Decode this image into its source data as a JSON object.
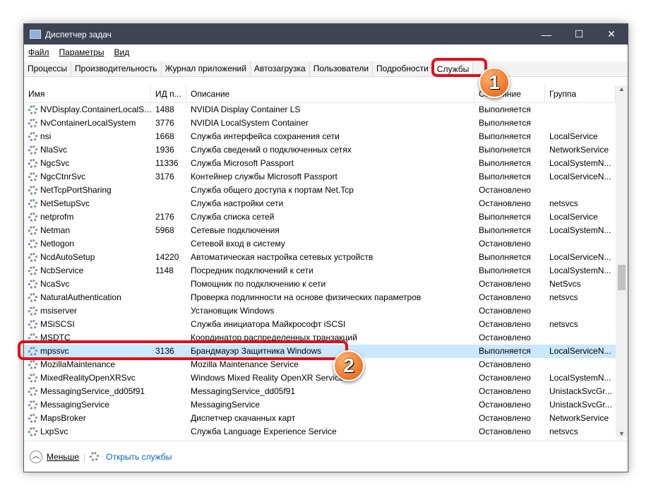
{
  "window": {
    "title": "Диспетчер задач",
    "minimize": "—",
    "maximize": "☐",
    "close": "✕"
  },
  "menu": [
    "Файл",
    "Параметры",
    "Вид"
  ],
  "tabs": [
    "Процессы",
    "Производительность",
    "Журнал приложений",
    "Автозагрузка",
    "Пользователи",
    "Подробности",
    "Службы"
  ],
  "active_tab": "Службы",
  "columns": [
    "Имя",
    "ИД п...",
    "Описание",
    "Состояние",
    "Группа"
  ],
  "rows": [
    [
      "NVDisplay.ContainerLocalS...",
      "1488",
      "NVIDIA Display Container LS",
      "Выполняется",
      ""
    ],
    [
      "NvContainerLocalSystem",
      "3776",
      "NVIDIA LocalSystem Container",
      "Выполняется",
      ""
    ],
    [
      "nsi",
      "1668",
      "Служба интерфейса сохранения сети",
      "Выполняется",
      "LocalService"
    ],
    [
      "NlaSvc",
      "1936",
      "Служба сведений о подключенных сетях",
      "Выполняется",
      "NetworkService"
    ],
    [
      "NgcSvc",
      "11336",
      "Служба Microsoft Passport",
      "Выполняется",
      "LocalSystemN..."
    ],
    [
      "NgcCtnrSvc",
      "3176",
      "Контейнер службы Microsoft Passport",
      "Выполняется",
      "LocalServiceN..."
    ],
    [
      "NetTcpPortSharing",
      "",
      "Служба общего доступа к портам Net.Tcp",
      "Остановлено",
      ""
    ],
    [
      "NetSetupSvc",
      "",
      "Служба настройки сети",
      "Остановлено",
      "netsvcs"
    ],
    [
      "netprofm",
      "2176",
      "Служба списка сетей",
      "Выполняется",
      "LocalService"
    ],
    [
      "Netman",
      "5968",
      "Сетевые подключения",
      "Выполняется",
      "LocalSystemN..."
    ],
    [
      "Netlogon",
      "",
      "Сетевой вход в систему",
      "Остановлено",
      ""
    ],
    [
      "NcdAutoSetup",
      "14220",
      "Автоматическая настройка сетевых устройств",
      "Выполняется",
      "LocalServiceN..."
    ],
    [
      "NcbService",
      "1148",
      "Посредник подключений к сети",
      "Выполняется",
      "LocalSystemN..."
    ],
    [
      "NcaSvc",
      "",
      "Помощник по подключению к сети",
      "Остановлено",
      "NetSvcs"
    ],
    [
      "NaturalAuthentication",
      "",
      "Проверка подлинности на основе физических параметров",
      "Остановлено",
      "netsvcs"
    ],
    [
      "msiserver",
      "",
      "Установщик Windows",
      "Остановлено",
      ""
    ],
    [
      "MSiSCSI",
      "",
      "Служба инициатора Майкрософт iSCSI",
      "Остановлено",
      "netsvcs"
    ],
    [
      "MSDTC",
      "",
      "Координатор распределенных транзакций",
      "Остановлено",
      ""
    ],
    [
      "mpssvc",
      "3136",
      "Брандмауэр Защитника Windows",
      "Выполняется",
      "LocalServiceN..."
    ],
    [
      "MozillaMaintenance",
      "",
      "Mozilla Maintenance Service",
      "Остановлено",
      ""
    ],
    [
      "MixedRealityOpenXRSvc",
      "",
      "Windows Mixed Reality OpenXR Service",
      "Остановлено",
      "LocalSystemN..."
    ],
    [
      "MessagingService_dd05f91",
      "",
      "MessagingService_dd05f91",
      "Остановлено",
      "UnistackSvcGr..."
    ],
    [
      "MessagingService",
      "",
      "MessagingService",
      "Остановлено",
      "UnistackSvcGr..."
    ],
    [
      "MapsBroker",
      "",
      "Диспетчер скачанных карт",
      "Остановлено",
      "NetworkService"
    ],
    [
      "LxpSvc",
      "",
      "Служба Language Experience Service",
      "Остановлено",
      "netsvcs"
    ]
  ],
  "selected_row": 18,
  "footer": {
    "less": "Меньше",
    "open_services": "Открыть службы"
  },
  "badges": [
    "1",
    "2"
  ]
}
